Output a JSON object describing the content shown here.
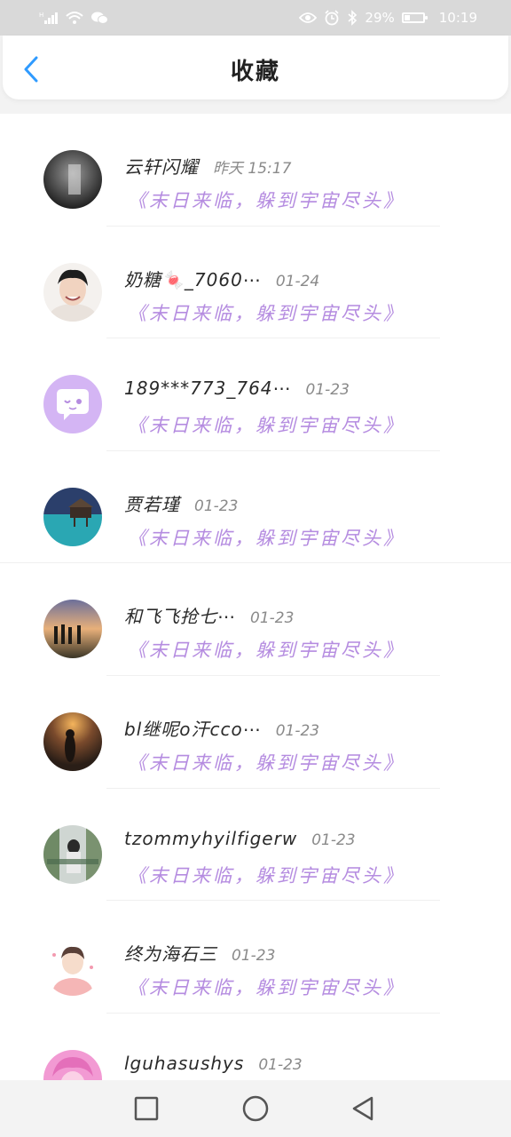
{
  "status_bar": {
    "battery": "29%",
    "time": "10:19",
    "battery_level": 0.29,
    "icons": [
      "signal-icon",
      "wifi-icon",
      "wechat-icon",
      "eye-icon",
      "alarm-icon",
      "bluetooth-icon",
      "battery-icon"
    ]
  },
  "header": {
    "title": "收藏",
    "back_icon": "back-chevron-icon"
  },
  "list": {
    "items": [
      {
        "name": "云轩闪耀",
        "time": "昨天 15:17",
        "quote": "《末日来临，躲到宇宙尽头》"
      },
      {
        "name": "奶糖🍬_7060⋯",
        "time": "01-24",
        "quote": "《末日来临，躲到宇宙尽头》"
      },
      {
        "name": "189***773_764⋯",
        "time": "01-23",
        "quote": "《末日来临，躲到宇宙尽头》"
      },
      {
        "name": "贾若瑾",
        "time": "01-23",
        "quote": "《末日来临，躲到宇宙尽头》"
      },
      {
        "name": "和飞飞抢七⋯",
        "time": "01-23",
        "quote": "《末日来临，躲到宇宙尽头》"
      },
      {
        "name": "bl继呢o汗cco⋯",
        "time": "01-23",
        "quote": "《末日来临，躲到宇宙尽头》"
      },
      {
        "name": "tzommyhyilfigerw",
        "time": "01-23",
        "quote": "《末日来临，躲到宇宙尽头》"
      },
      {
        "name": "终为海石三",
        "time": "01-23",
        "quote": "《末日来临，躲到宇宙尽头》"
      },
      {
        "name": "lguhasushys",
        "time": "01-23",
        "quote": ""
      }
    ]
  },
  "colors": {
    "accent": "#2f9bff",
    "quote": "#b58ce0",
    "status_bar_bg": "#d9d9d9"
  },
  "navbar": {
    "icons": [
      "recents-square-icon",
      "home-circle-icon",
      "back-triangle-icon"
    ]
  }
}
